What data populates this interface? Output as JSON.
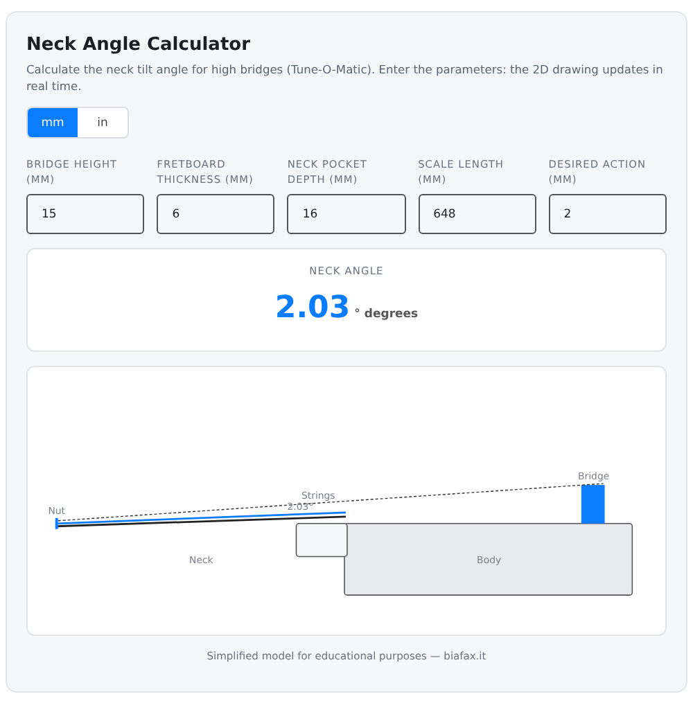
{
  "title": "Neck Angle Calculator",
  "description": "Calculate the neck tilt angle for high bridges (Tune-O-Matic). Enter the parameters: the 2D drawing updates in real time.",
  "units": [
    {
      "label": "mm",
      "selected": true
    },
    {
      "label": "in",
      "selected": false
    }
  ],
  "fields": [
    {
      "label": "BRIDGE HEIGHT (MM)",
      "value": "15"
    },
    {
      "label": "FRETBOARD THICKNESS (MM)",
      "value": "6"
    },
    {
      "label": "NECK POCKET DEPTH (MM)",
      "value": "16"
    },
    {
      "label": "SCALE LENGTH (MM)",
      "value": "648"
    },
    {
      "label": "DESIRED ACTION (MM)",
      "value": "2"
    }
  ],
  "result": {
    "label": "NECK ANGLE",
    "value": "2.03",
    "unit": "° degrees"
  },
  "diagram": {
    "nut": "Nut",
    "strings": "Strings",
    "angle": "2.03°",
    "neck": "Neck",
    "body": "Body",
    "bridge": "Bridge"
  },
  "footer": "Simplified model for educational purposes — biafax.it"
}
